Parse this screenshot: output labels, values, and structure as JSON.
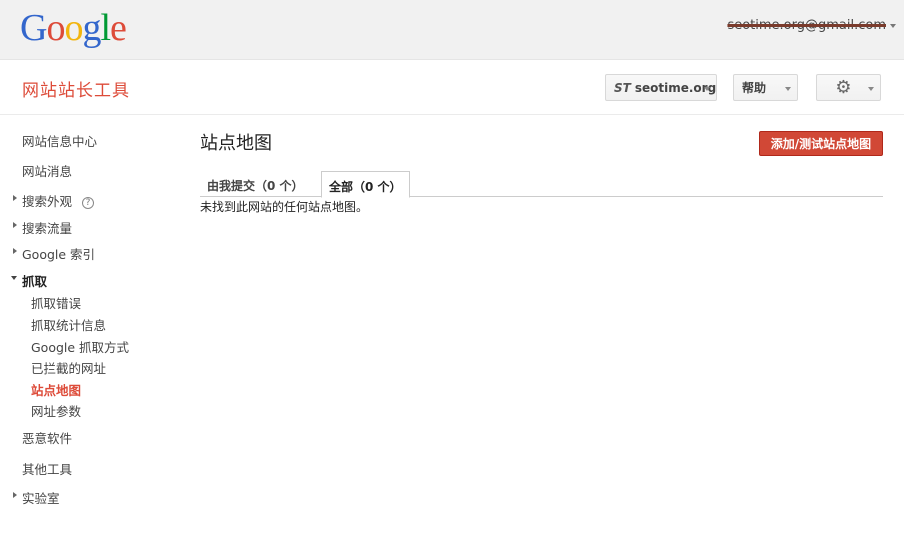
{
  "topbar": {
    "logo_letters": [
      {
        "ch": "G",
        "color": "#3366cc"
      },
      {
        "ch": "o",
        "color": "#dd4b39"
      },
      {
        "ch": "o",
        "color": "#f2b50f"
      },
      {
        "ch": "g",
        "color": "#3366cc"
      },
      {
        "ch": "l",
        "color": "#009933"
      },
      {
        "ch": "e",
        "color": "#dd4b39"
      }
    ],
    "account": "seotime.org@gmail.com"
  },
  "header": {
    "app_title": "网站站长工具",
    "site_icon": "ST",
    "site_label": "seotime.org",
    "help_label": "帮助",
    "gear_icon": "gear-icon"
  },
  "sidebar": {
    "items": [
      {
        "label": "网站信息中心"
      },
      {
        "label": "网站消息"
      },
      {
        "label": "搜索外观",
        "help": "?"
      },
      {
        "label": "搜索流量"
      },
      {
        "label": "Google 索引"
      },
      {
        "label": "抓取"
      },
      {
        "label": "抓取错误"
      },
      {
        "label": "抓取统计信息"
      },
      {
        "label": "Google 抓取方式"
      },
      {
        "label": "已拦截的网址"
      },
      {
        "label": "站点地图"
      },
      {
        "label": "网址参数"
      },
      {
        "label": "恶意软件"
      },
      {
        "label": "其他工具"
      },
      {
        "label": "实验室"
      }
    ]
  },
  "main": {
    "title": "站点地图",
    "add_button": "添加/测试站点地图",
    "tabs": [
      {
        "label": "由我提交（0 个）"
      },
      {
        "label": "全部（0 个）"
      }
    ],
    "empty_message": "未找到此网站的任何站点地图。"
  }
}
